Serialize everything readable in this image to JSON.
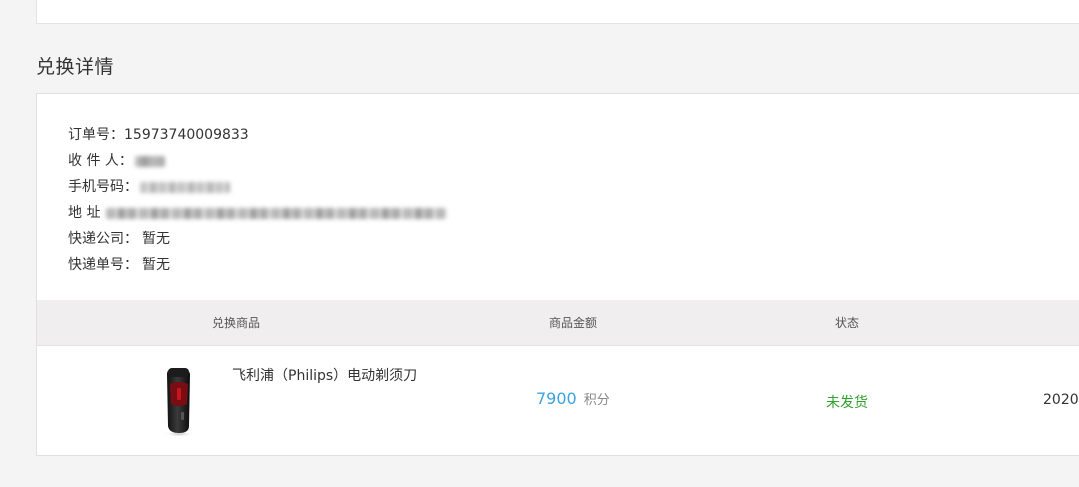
{
  "section_title": "兑换详情",
  "order": {
    "order_no_label": "订单号：",
    "order_no": "15973740009833",
    "recipient_label": "收 件 人：",
    "phone_label": "手机号码：",
    "address_label": "地 址",
    "courier_label": "快递公司：",
    "courier_value": "暂无",
    "tracking_label": "快递单号：",
    "tracking_value": "暂无"
  },
  "table": {
    "headers": [
      "兑换商品",
      "商品金额",
      "状态"
    ],
    "rows": [
      {
        "product_name": "飞利浦（Philips）电动剃须刀",
        "amount": "7900",
        "unit": "积分",
        "status": "未发货",
        "date": "2020-"
      }
    ]
  },
  "colors": {
    "amount": "#3aa3e3",
    "status": "#2fa12f",
    "header_bg": "#f0eeef"
  }
}
